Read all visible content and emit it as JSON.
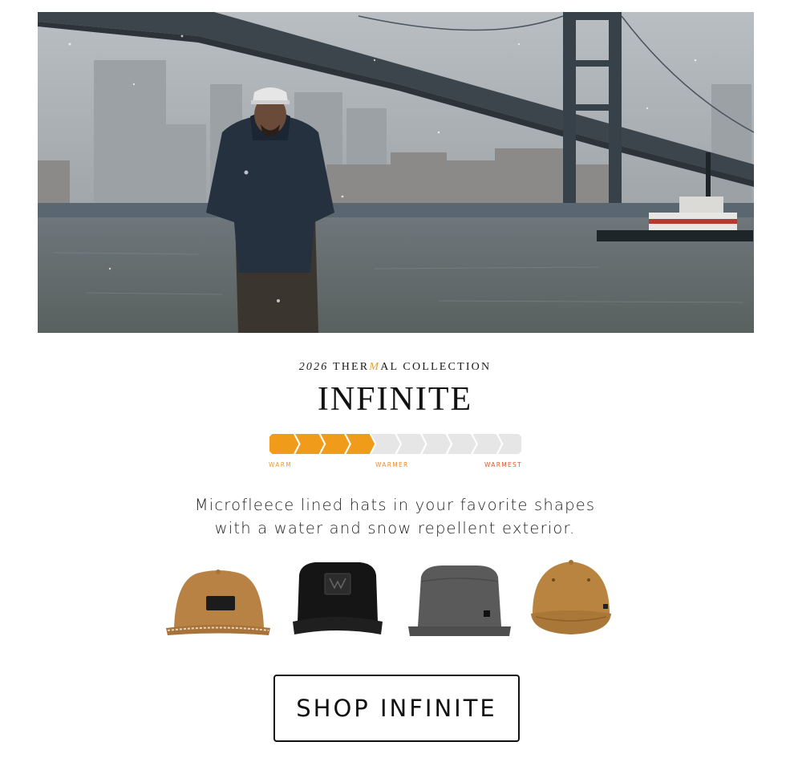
{
  "hero": {
    "image": "man-in-jacket-under-bridge-snow-photo"
  },
  "collection": {
    "year": "2026",
    "name_before": "THER",
    "name_accent": "M",
    "name_after": "AL COLLECTION",
    "title": "INFINITE"
  },
  "warmth_meter": {
    "level": 4,
    "total_segments": 10,
    "colors": {
      "filled": "#f19b1a",
      "empty": "#e6e6e6"
    },
    "labels": {
      "warm": "WARM",
      "warmer": "WARMER",
      "warmest": "WARMEST"
    }
  },
  "description": {
    "line1": "Microfleece lined hats in your favorite shapes",
    "line2": "with a water and snow repellent exterior."
  },
  "hats": [
    {
      "name": "tan-rope-snapback-hat-icon",
      "color": "#b98245"
    },
    {
      "name": "black-trucker-hat-icon",
      "color": "#151515"
    },
    {
      "name": "grey-flatbrim-hat-icon",
      "color": "#5a5a5a"
    },
    {
      "name": "tan-curved-brim-hat-icon",
      "color": "#b8843f"
    }
  ],
  "cta": {
    "label": "SHOP INFINITE"
  }
}
